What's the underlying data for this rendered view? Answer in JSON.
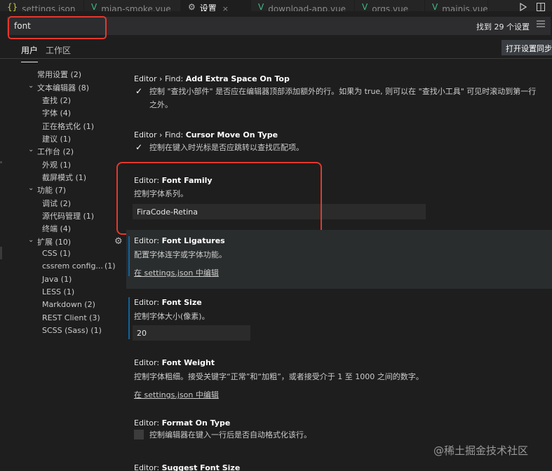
{
  "tabs": [
    {
      "icon": "{}",
      "label": "settings.json"
    },
    {
      "icon": "V",
      "label": "mian-smoke.vue"
    },
    {
      "icon": "⚙",
      "label": "设置"
    },
    {
      "icon": "V",
      "label": "download-app.vue"
    },
    {
      "icon": "V",
      "label": "orgs.vue"
    },
    {
      "icon": "V",
      "label": "mainis.vue"
    }
  ],
  "tab_close": "×",
  "search": {
    "value": "font",
    "results": "找到 29 个设置"
  },
  "scopes": {
    "user": "用户",
    "workspace": "工作区",
    "sync_button": "打开设置同步"
  },
  "toc": {
    "common": "常用设置 (2)",
    "text_editor": "文本编辑器 (8)",
    "find": "查找 (2)",
    "font": "字体 (4)",
    "formatting": "正在格式化 (1)",
    "suggestions": "建议 (1)",
    "workbench": "工作台 (2)",
    "appearance": "外观 (1)",
    "screencast": "截屏模式 (1)",
    "features": "功能 (7)",
    "debug": "调试 (2)",
    "scm": "源代码管理 (1)",
    "terminal": "终端 (4)",
    "extensions": "扩展 (10)",
    "css": "CSS (1)",
    "cssrem": "cssrem config...",
    "cssrem_count": "(1)",
    "java": "Java (1)",
    "less": "LESS (1)",
    "markdown": "Markdown (2)",
    "rest": "REST Client (3)",
    "scss": "SCSS (Sass) (1)"
  },
  "settings": {
    "extra_space": {
      "prefix": "Editor › Find: ",
      "name": "Add Extra Space On Top",
      "desc": "控制 \"查找小部件\" 是否应在编辑器顶部添加额外的行。如果为 true, 则可以在 \"查找小工具\" 可见时滚动到第一行之外。"
    },
    "cursor_move": {
      "prefix": "Editor › Find: ",
      "name": "Cursor Move On Type",
      "desc": "控制在键入时光标是否应跳转以查找匹配项。"
    },
    "font_family": {
      "prefix": "Editor: ",
      "name": "Font Family",
      "desc": "控制字体系列。",
      "value": "FiraCode-Retina"
    },
    "font_ligatures": {
      "prefix": "Editor: ",
      "name": "Font Ligatures",
      "desc": "配置字体连字或字体功能。",
      "link": "在 settings.json 中编辑"
    },
    "font_size": {
      "prefix": "Editor: ",
      "name": "Font Size",
      "desc": "控制字体大小(像素)。",
      "value": "20"
    },
    "font_weight": {
      "prefix": "Editor: ",
      "name": "Font Weight",
      "desc": "控制字体粗细。接受关键字“正常”和“加粗”，或者接受介于 1 至 1000 之间的数字。",
      "link": "在 settings.json 中编辑"
    },
    "format_on_type": {
      "prefix": "Editor: ",
      "name": "Format On Type",
      "desc": "控制编辑器在键入一行后是否自动格式化该行。"
    },
    "suggest_font_size": {
      "prefix": "Editor: ",
      "name": "Suggest Font Size"
    }
  },
  "watermark": "@稀土掘金技术社区",
  "colors": {
    "accent_bar": "#0e639c",
    "highlight_box": "#e5372d",
    "vue_icon": "#41b883"
  }
}
